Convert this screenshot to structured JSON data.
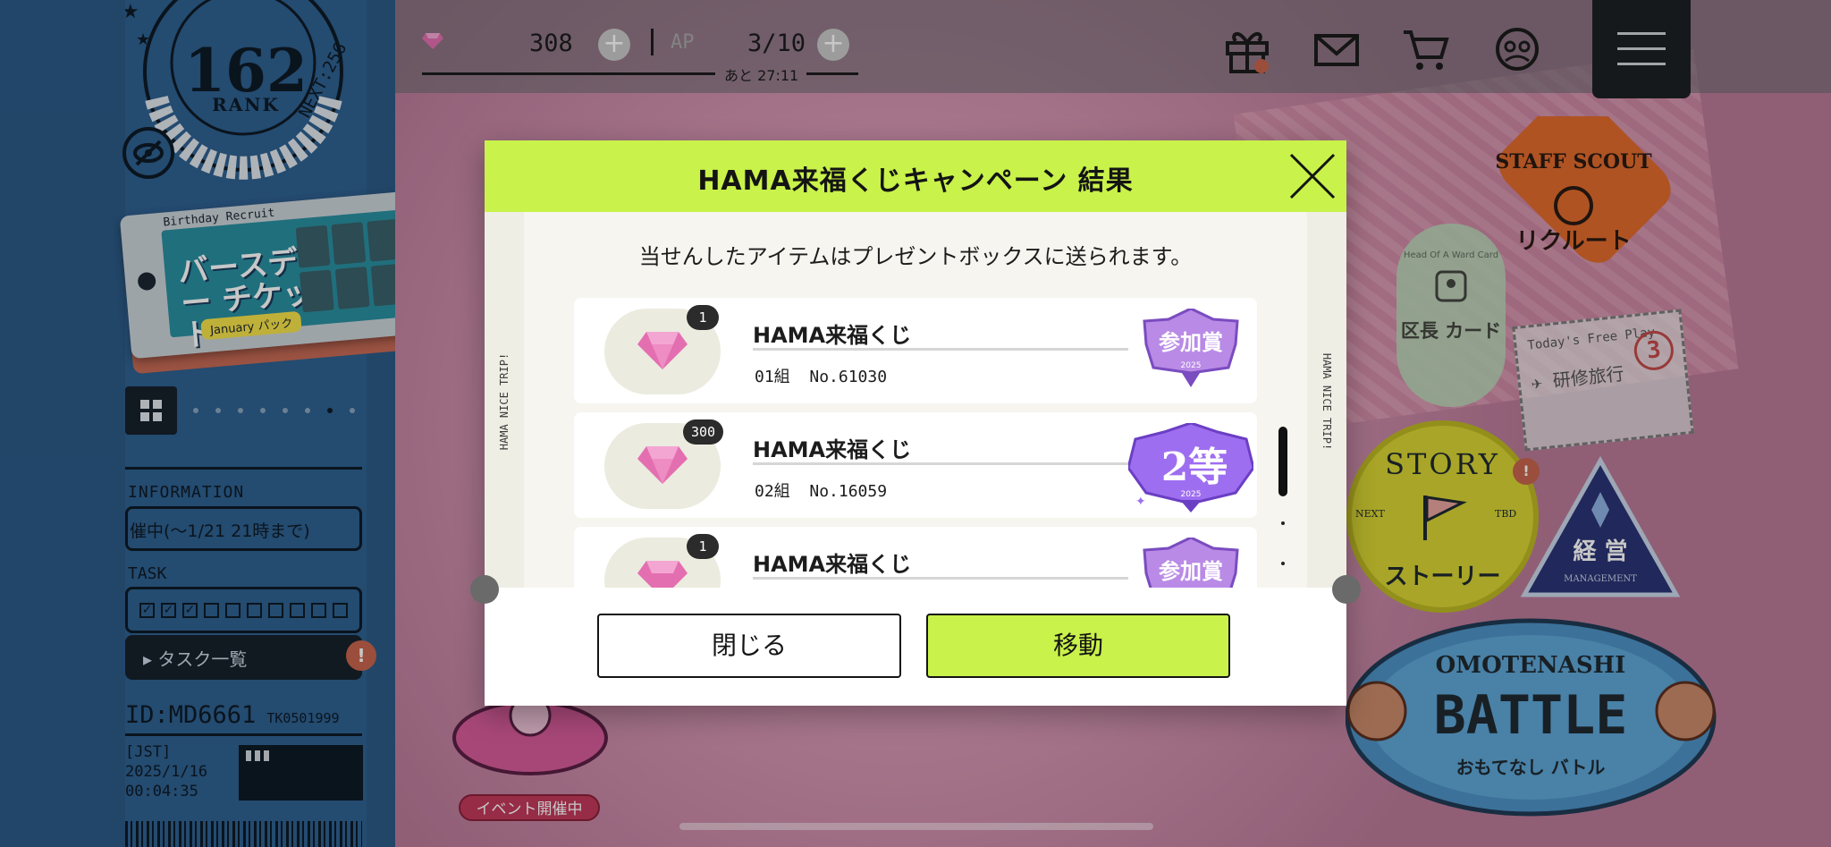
{
  "player": {
    "rank": "162",
    "rank_label": "RANK",
    "next": "NEXT:256",
    "id": "ID:MD6661",
    "trainer_code": "TK0501999",
    "timezone": "[JST]",
    "date": "2025/1/16",
    "time": "00:04:35"
  },
  "left_panel": {
    "ticket_title": "Birthday Recruit",
    "ticket_big": "バースデー チケット",
    "ticket_pack": "January パック",
    "info_title": "INFORMATION",
    "info_text": "催中(～1/21 21時まで)",
    "task_title": "TASK",
    "task_checks": [
      "✓",
      "✓",
      "✓",
      "",
      "",
      "",
      "",
      "",
      "",
      ""
    ],
    "task_button": "▸ タスク一覧",
    "task_alert": "!"
  },
  "hud": {
    "gems": "308",
    "ap_label": "AP",
    "ap_value": "3/10",
    "ap_timer": "あと 27:11"
  },
  "top_icons": [
    "gift-icon",
    "mail-icon",
    "cart-icon",
    "profile-icon",
    "menu-icon"
  ],
  "stage": {
    "staff_scout_title": "STAFF SCOUT",
    "staff_scout_sub": "リクルート",
    "head_card_small": "Head Of A Ward Card",
    "head_card_big": "区長 カード",
    "stamp_small": "Today's Free Play",
    "stamp_big": "研修旅行",
    "stamp_num": "3",
    "story_top": "STORY",
    "story_bottom": "ストーリー",
    "story_next": "NEXT",
    "story_tbd": "TBD",
    "story_alert": "!",
    "keiei": "経 営",
    "keiei_sub": "MANAGEMENT",
    "battle_top": "OMOTENASHI",
    "battle_main": "BATTLE",
    "battle_sub": "おもてなし バトル",
    "event_pill": "イベント開催中"
  },
  "modal": {
    "title": "HAMA来福くじキャンペーン 結果",
    "notice": "当せんしたアイテムはプレゼントボックスに送られます。",
    "side_text": "HAMA NICE TRIP!",
    "prizes": [
      {
        "count": "1",
        "name": "HAMA来福くじ",
        "group": "01組",
        "number": "No.61030",
        "badge": "参加賞",
        "year": "2025"
      },
      {
        "count": "300",
        "name": "HAMA来福くじ",
        "group": "02組",
        "number": "No.16059",
        "badge": "2等",
        "year": "2025"
      },
      {
        "count": "1",
        "name": "HAMA来福くじ",
        "group": "",
        "number": "",
        "badge": "参加賞",
        "year": ""
      }
    ],
    "close_button": "閉じる",
    "move_button": "移動"
  },
  "colors": {
    "accent": "#c9f24a",
    "panel": "#2c5a86",
    "alert": "#c7654c",
    "gem": "#e36fb0"
  }
}
